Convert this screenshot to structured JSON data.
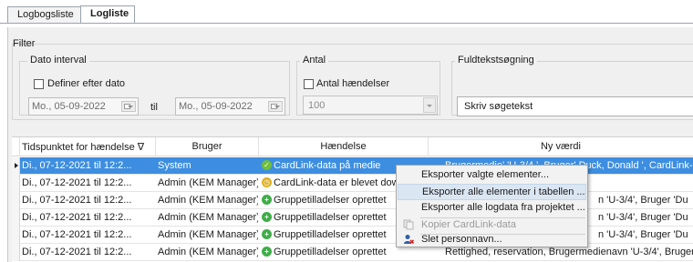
{
  "tabs": [
    {
      "label": "Logbogsliste",
      "active": false
    },
    {
      "label": "Logliste",
      "active": true
    }
  ],
  "filter": {
    "title": "Filter",
    "date_interval": {
      "label": "Dato interval",
      "checkbox_label": "Definer efter dato",
      "checked": false,
      "from_value": "Mo., 05-09-2022",
      "separator": "til",
      "to_value": "Mo., 05-09-2022"
    },
    "count": {
      "label": "Antal",
      "checkbox_label": "Antal hændelser",
      "checked": false,
      "value": "100"
    },
    "fulltext": {
      "label": "Fuldtekstsøgning",
      "value": "Skriv søgetekst"
    }
  },
  "grid": {
    "columns": [
      "Tidspunktet for hændelse ∇",
      "Bruger",
      "Hændelse",
      "Ny værdi"
    ],
    "rows": [
      {
        "time": "Di., 07-12-2021 til 12:2...",
        "user": "System",
        "event": "CardLink-data på medie",
        "event_icon": "check-circle-icon",
        "icon_color": "#6fbf3a",
        "new_value": "Brugermedie' 'U-3/4 ', Bruger' Duck, Donald ', CardLink-opd",
        "selected": true
      },
      {
        "time": "Di., 07-12-2021 til 12:2...",
        "user": "Admin (KEM Manager)",
        "event": "CardLink-data er blevet downl",
        "event_icon": "clock-circle-icon",
        "icon_color": "#e0b020",
        "new_value": "",
        "selected": false
      },
      {
        "time": "Di., 07-12-2021 til 12:2...",
        "user": "Admin (KEM Manager)",
        "event": "Gruppetilladelser oprettet",
        "event_icon": "plus-circle-icon",
        "icon_color": "#3fae49",
        "new_value": "n 'U-3/4', Bruger 'Du",
        "selected": false
      },
      {
        "time": "Di., 07-12-2021 til 12:2...",
        "user": "Admin (KEM Manager)",
        "event": "Gruppetilladelser oprettet",
        "event_icon": "plus-circle-icon",
        "icon_color": "#3fae49",
        "new_value": "n 'U-3/4', Bruger 'Du",
        "selected": false
      },
      {
        "time": "Di., 07-12-2021 til 12:2...",
        "user": "Admin (KEM Manager)",
        "event": "Gruppetilladelser oprettet",
        "event_icon": "plus-circle-icon",
        "icon_color": "#3fae49",
        "new_value": "n 'U-3/4', Bruger 'Du",
        "selected": false
      },
      {
        "time": "Di., 07-12-2021 til 12:2...",
        "user": "Admin (KEM Manager)",
        "event": "Gruppetilladelser oprettet",
        "event_icon": "plus-circle-icon",
        "icon_color": "#3fae49",
        "new_value": "Rettighed, reservation, Brugermedienavn 'U-3/4', Bruger 'Du",
        "selected": false
      }
    ]
  },
  "context_menu": {
    "items": [
      {
        "label": "Eksporter valgte elementer...",
        "enabled": true,
        "highlighted": false,
        "icon": ""
      },
      {
        "label": "Eksporter alle elementer i tabellen ...",
        "enabled": true,
        "highlighted": true,
        "icon": ""
      },
      {
        "label": "Eksporter alle logdata fra projektet ...",
        "enabled": true,
        "highlighted": false,
        "icon": ""
      },
      {
        "label": "Kopier CardLink-data",
        "enabled": false,
        "highlighted": false,
        "icon": "copy-icon"
      },
      {
        "label": "Slet personnavn...",
        "enabled": true,
        "highlighted": false,
        "icon": "delete-person-icon"
      }
    ]
  },
  "colors": {
    "selection": "#3d8ee0",
    "menu_highlight": "#dbe6f3",
    "panel_bg": "#f0f0f0"
  }
}
